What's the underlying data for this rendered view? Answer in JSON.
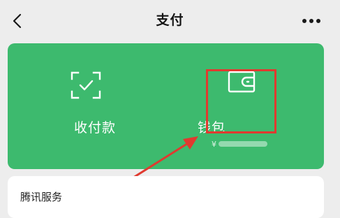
{
  "nav": {
    "title": "支付",
    "back_icon": "chevron-left-icon",
    "more_icon": "more-dots-icon"
  },
  "card": {
    "color": "#3dba6e",
    "receive": {
      "label": "收付款",
      "icon": "scan-check-icon"
    },
    "wallet": {
      "label": "钱包",
      "icon": "wallet-icon",
      "amount_prefix": "¥"
    }
  },
  "annotation": {
    "color": "#e03a2f"
  },
  "services": {
    "title": "腾讯服务"
  }
}
